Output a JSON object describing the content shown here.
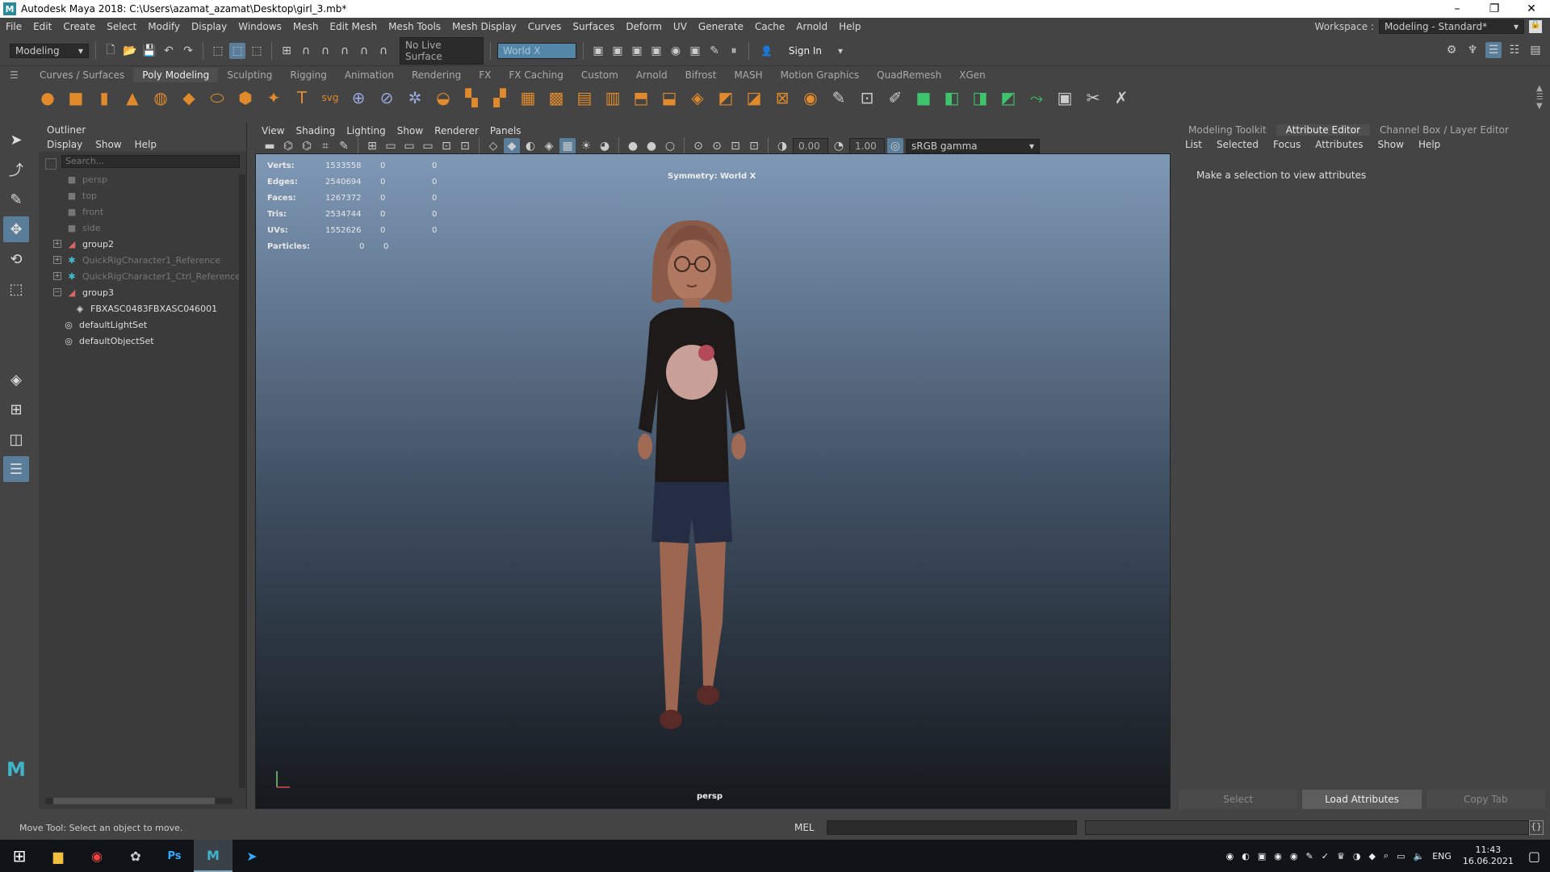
{
  "window": {
    "title": "Autodesk Maya 2018: C:\\Users\\azamat_azamat\\Desktop\\girl_3.mb*",
    "minimize": "–",
    "maximize": "❐",
    "close": "✕"
  },
  "menubar": {
    "items": [
      "File",
      "Edit",
      "Create",
      "Select",
      "Modify",
      "Display",
      "Windows",
      "Mesh",
      "Edit Mesh",
      "Mesh Tools",
      "Mesh Display",
      "Curves",
      "Surfaces",
      "Deform",
      "UV",
      "Generate",
      "Cache",
      "Arnold",
      "Help"
    ],
    "workspace_label": "Workspace :",
    "workspace_value": "Modeling - Standard*"
  },
  "statusline": {
    "menuset": "Modeling",
    "live_surface": "No Live Surface",
    "symmetry": "World X",
    "sign_in": "Sign In"
  },
  "shelf": {
    "tabs": [
      "Curves / Surfaces",
      "Poly Modeling",
      "Sculpting",
      "Rigging",
      "Animation",
      "Rendering",
      "FX",
      "FX Caching",
      "Custom",
      "Arnold",
      "Bifrost",
      "MASH",
      "Motion Graphics",
      "QuadRemesh",
      "XGen"
    ],
    "active_tab": "Poly Modeling"
  },
  "outliner": {
    "title": "Outliner",
    "menu": [
      "Display",
      "Show",
      "Help"
    ],
    "search_placeholder": "Search...",
    "rows": [
      {
        "label": "persp",
        "dim": true
      },
      {
        "label": "top",
        "dim": true
      },
      {
        "label": "front",
        "dim": true
      },
      {
        "label": "side",
        "dim": true
      },
      {
        "label": "group2"
      },
      {
        "label": "QuickRigCharacter1_Reference",
        "dim": true
      },
      {
        "label": "QuickRigCharacter1_Ctrl_Reference",
        "dim": true
      },
      {
        "label": "group3"
      },
      {
        "label": "FBXASC0483FBXASC046001"
      },
      {
        "label": "defaultLightSet"
      },
      {
        "label": "defaultObjectSet"
      }
    ]
  },
  "viewport": {
    "menu": [
      "View",
      "Shading",
      "Lighting",
      "Show",
      "Renderer",
      "Panels"
    ],
    "exposure": "0.00",
    "gamma": "1.00",
    "color_space": "sRGB gamma",
    "hud": [
      {
        "key": "Verts:",
        "v": "1533558",
        "a": "0",
        "b": "0"
      },
      {
        "key": "Edges:",
        "v": "2540694",
        "a": "0",
        "b": "0"
      },
      {
        "key": "Faces:",
        "v": "1267372",
        "a": "0",
        "b": "0"
      },
      {
        "key": "Tris:",
        "v": "2534744",
        "a": "0",
        "b": "0"
      },
      {
        "key": "UVs:",
        "v": "1552626",
        "a": "0",
        "b": "0"
      },
      {
        "key": "Particles:",
        "v": "",
        "a": "0",
        "b": "0"
      }
    ],
    "symmetry_label": "Symmetry: World X",
    "camera": "persp"
  },
  "right_panel": {
    "tabs": [
      "Modeling Toolkit",
      "Attribute Editor",
      "Channel Box / Layer Editor"
    ],
    "active_tab": "Attribute Editor",
    "menu": [
      "List",
      "Selected",
      "Focus",
      "Attributes",
      "Show",
      "Help"
    ],
    "message": "Make a selection to view attributes",
    "buttons": [
      "Select",
      "Load Attributes",
      "Copy Tab"
    ]
  },
  "helpline": {
    "text": "Move Tool: Select an object to move.",
    "mel": "MEL"
  },
  "taskbar": {
    "language": "ENG",
    "time": "11:43",
    "date": "16.06.2021",
    "ps": "Ps"
  }
}
